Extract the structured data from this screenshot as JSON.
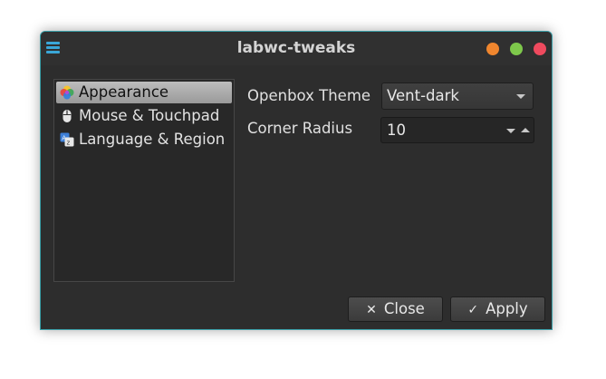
{
  "window": {
    "title": "labwc-tweaks",
    "menu_icon": "hamburger-menu-icon",
    "controls": {
      "minimize_color": "#f0862e",
      "maximize_color": "#7ec84b",
      "close_color": "#ef4a5e"
    },
    "border_color": "#3a9fa8"
  },
  "sidebar": {
    "items": [
      {
        "label": "Appearance",
        "icon": "appearance-palette-icon",
        "selected": true
      },
      {
        "label": "Mouse & Touchpad",
        "icon": "mouse-icon",
        "selected": false
      },
      {
        "label": "Language & Region",
        "icon": "language-translate-icon",
        "selected": false
      }
    ]
  },
  "settings": {
    "openbox_theme": {
      "label": "Openbox Theme",
      "value": "Vent-dark"
    },
    "corner_radius": {
      "label": "Corner Radius",
      "value": "10"
    }
  },
  "buttons": {
    "close": {
      "label": "Close",
      "glyph": "✕"
    },
    "apply": {
      "label": "Apply",
      "glyph": "✓"
    }
  }
}
